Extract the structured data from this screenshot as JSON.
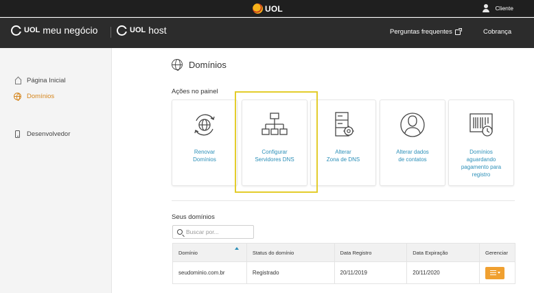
{
  "topbar": {
    "brand": "UOL",
    "user_label": "Cliente"
  },
  "brandbar": {
    "logo1_uol": "UOL",
    "logo1_name": "meu negócio",
    "logo2_uol": "UOL",
    "logo2_name": "host",
    "faq_label": "Perguntas frequentes",
    "billing_label": "Cobrança"
  },
  "sidebar": {
    "items": [
      {
        "label": "Página Inicial",
        "icon": "home-icon"
      },
      {
        "label": "Domínios",
        "icon": "globe-icon",
        "active": true
      },
      {
        "label": "Desenvolvedor",
        "icon": "phone-icon"
      }
    ]
  },
  "main": {
    "title": "Domínios",
    "actions_label": "Ações no painel",
    "cards": [
      {
        "label": "Renovar\nDomínios",
        "icon": "renew-globe-icon"
      },
      {
        "label": "Configurar\nServidores DNS",
        "icon": "network-tree-icon"
      },
      {
        "label": "Alterar\nZona de DNS",
        "icon": "server-gear-icon"
      },
      {
        "label": "Alterar dados\nde contatos",
        "icon": "user-circle-icon"
      },
      {
        "label": "Domínios\naguardando\npagamento para\nregistro",
        "icon": "barcode-clock-icon"
      }
    ],
    "domains_label": "Seus domínios",
    "search_placeholder": "Buscar por...",
    "table": {
      "headers": [
        "Domínio",
        "Status do domínio",
        "Data Registro",
        "Data Expiração",
        "Gerenciar"
      ],
      "rows": [
        [
          "seudominio.com.br",
          "Registrado",
          "20/11/2019",
          "20/11/2020"
        ]
      ]
    }
  },
  "colors": {
    "accent_orange": "#f0a030",
    "link_blue": "#2b8fb8",
    "highlight_yellow": "#e3cc2a"
  }
}
